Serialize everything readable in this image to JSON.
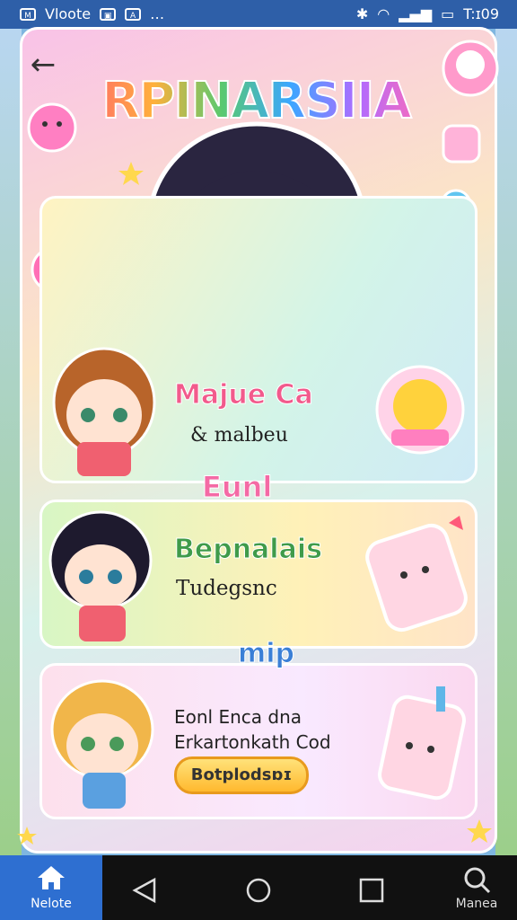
{
  "status_bar": {
    "app_label": "Vloote",
    "time": "T:ɪ09"
  },
  "header": {
    "title": "RPINARSIIA",
    "back_icon": "back-arrow-icon"
  },
  "cards": [
    {
      "title": "Majue Ca",
      "subtitle": "& malbeu",
      "tag": "Eunl"
    },
    {
      "title": "Bepnalais",
      "subtitle": "Tudegsnc",
      "tag": "mip"
    },
    {
      "title": "Eonl Enca dna",
      "subtitle": "Erkartonkath Cod",
      "button": "Botplodsɒɪ"
    }
  ],
  "bottom_nav": {
    "home_label": "Nelote",
    "right_label": "Manea"
  },
  "colors": {
    "statusbar": "#2e5fa8",
    "home_tab": "#2e6fd1",
    "cta": "#ffb92e"
  }
}
